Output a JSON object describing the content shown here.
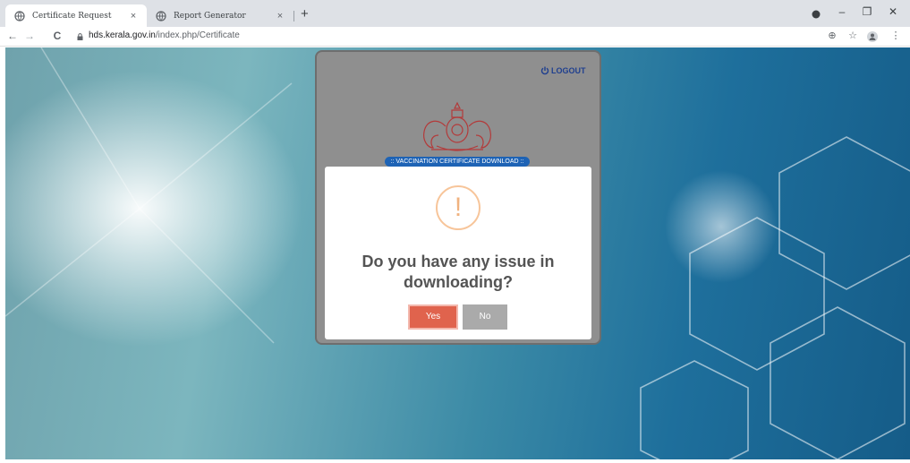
{
  "browser": {
    "tabs": [
      {
        "title": "Certificate Request",
        "active": true
      },
      {
        "title": "Report Generator",
        "active": false
      }
    ],
    "new_tab": "+",
    "close_glyph": "×",
    "window_controls": {
      "minimize": "–",
      "maximize": "❐",
      "close": "✕"
    },
    "nav": {
      "back": "←",
      "forward": "→",
      "reload": "C"
    },
    "url_host": "hds.kerala.gov.in",
    "url_path": "/index.php/Certificate",
    "toolbar_icons": {
      "zoom": "⊕",
      "star": "☆",
      "menu": "⋮"
    }
  },
  "header": {
    "logout_label": "LOGOUT"
  },
  "banner": {
    "label": ":: VACCINATION CERTIFICATE DOWNLOAD ::"
  },
  "dialog": {
    "icon_glyph": "!",
    "question": "Do you have any issue in downloading?",
    "yes_label": "Yes",
    "no_label": "No"
  },
  "colors": {
    "yes_button": "#e0634d",
    "no_button": "#aaaaaa",
    "warning_icon": "#f0b27f",
    "banner": "#1e63b5",
    "logout": "#1f3f8f"
  }
}
